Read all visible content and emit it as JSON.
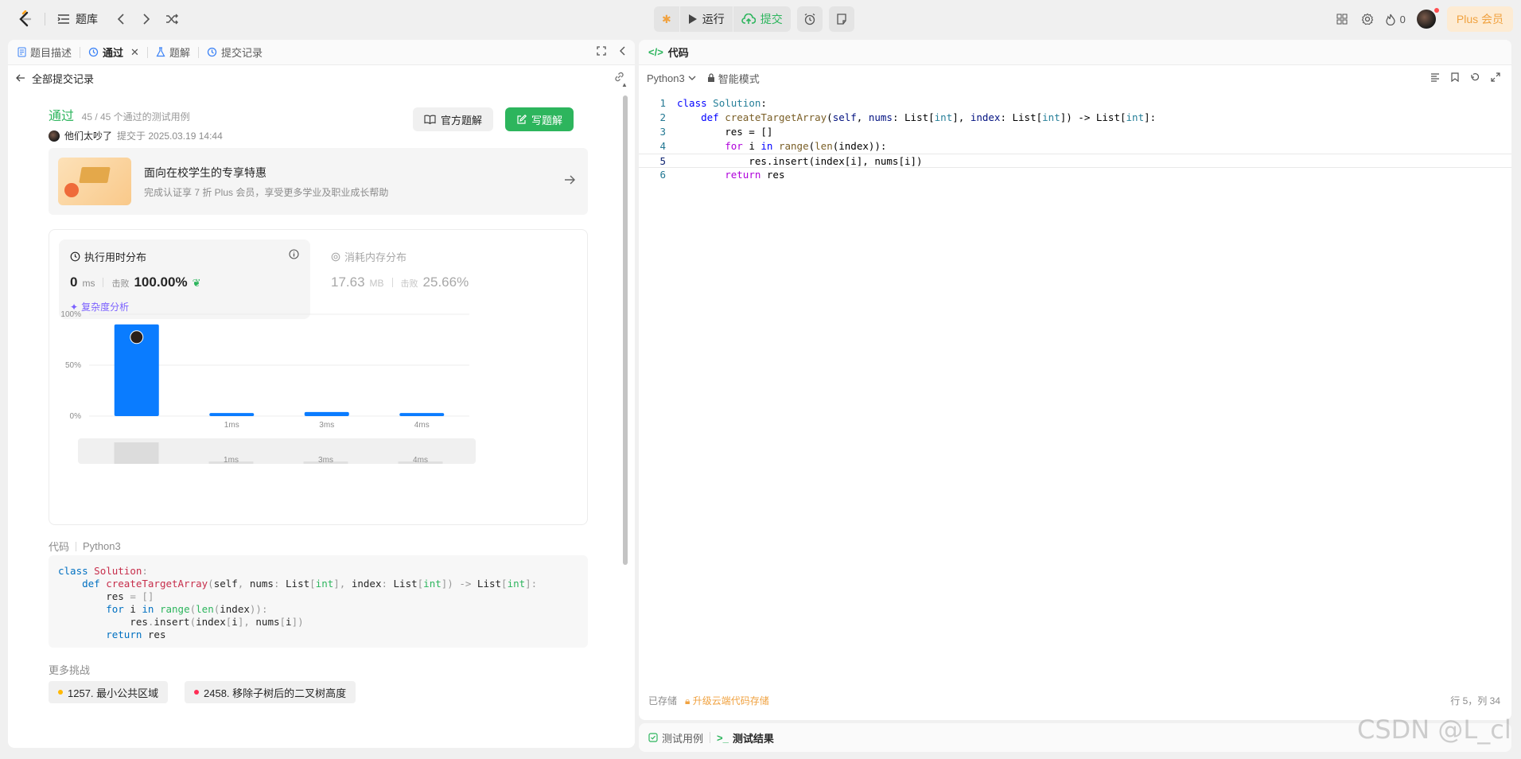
{
  "topbar": {
    "problem_bank": "题库",
    "run": "运行",
    "submit": "提交",
    "fire_count": "0",
    "plus": "Plus 会员"
  },
  "left_tabs": {
    "description": "题目描述",
    "accepted": "通过",
    "solutions": "题解",
    "submissions": "提交记录"
  },
  "back_label": "全部提交记录",
  "result": {
    "status": "通过",
    "cases": "45 / 45 个通过的测试用例",
    "user": "他们太吵了",
    "submitted_at": "提交于 2025.03.19 14:44",
    "official_btn": "官方题解",
    "write_btn": "写题解"
  },
  "promo": {
    "title": "面向在校学生的专享特惠",
    "subtitle": "完成认证享 7 折 Plus 会员，享受更多学业及职业成长帮助"
  },
  "runtime": {
    "title": "执行用时分布",
    "value": "0",
    "unit": "ms",
    "beat_label": "击败",
    "beat_value": "100.00%",
    "complexity": "复杂度分析"
  },
  "memory": {
    "title": "消耗内存分布",
    "value": "17.63",
    "unit": "MB",
    "beat_label": "击败",
    "beat_value": "25.66%"
  },
  "chart_data": {
    "type": "bar",
    "categories": [
      "",
      "1ms",
      "3ms",
      "4ms"
    ],
    "values": [
      90,
      3,
      4,
      3
    ],
    "ylim": [
      0,
      100
    ],
    "yticks": [
      "100%",
      "50%",
      "0%"
    ],
    "grid": true
  },
  "mini_nav_labels": [
    "1ms",
    "3ms",
    "4ms"
  ],
  "code_section": {
    "label": "代码",
    "language": "Python3"
  },
  "more": {
    "label": "更多挑战",
    "items": [
      {
        "text": "1257. 最小公共区域",
        "color": "#ffb800"
      },
      {
        "text": "2458. 移除子树后的二叉树高度",
        "color": "#ff2d55"
      }
    ]
  },
  "editor": {
    "tab": "代码",
    "language": "Python3",
    "mode": "智能模式",
    "saved": "已存储",
    "upgrade": "升级云端代码存储",
    "position": "行 5，列 34"
  },
  "bottom_tabs": {
    "testcase": "测试用例",
    "result": "测试结果"
  },
  "watermark": "CSDN @L_cl"
}
